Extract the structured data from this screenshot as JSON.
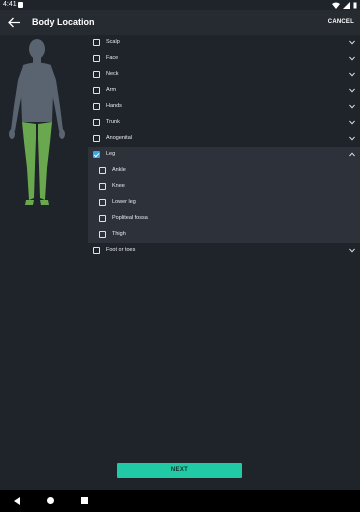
{
  "status_bar": {
    "time": "4:41",
    "icons": [
      "sim-icon",
      "wifi-icon",
      "signal-icon",
      "battery-icon"
    ]
  },
  "app_bar": {
    "back_icon": "arrow-left-icon",
    "title": "Body Location",
    "cancel_label": "CANCEL"
  },
  "figure": {
    "highlighted_region": "Leg",
    "body_color": "#5a6470",
    "highlight_color": "#6aa84f"
  },
  "locations": [
    {
      "label": "Scalp",
      "checked": false,
      "expanded": false
    },
    {
      "label": "Face",
      "checked": false,
      "expanded": false
    },
    {
      "label": "Neck",
      "checked": false,
      "expanded": false
    },
    {
      "label": "Arm",
      "checked": false,
      "expanded": false
    },
    {
      "label": "Hands",
      "checked": false,
      "expanded": false
    },
    {
      "label": "Trunk",
      "checked": false,
      "expanded": false
    },
    {
      "label": "Anogenital",
      "checked": false,
      "expanded": false
    },
    {
      "label": "Leg",
      "checked": true,
      "expanded": true,
      "children": [
        {
          "label": "Ankle",
          "checked": false
        },
        {
          "label": "Knee",
          "checked": false
        },
        {
          "label": "Lower leg",
          "checked": false
        },
        {
          "label": "Popliteal fossa",
          "checked": false
        },
        {
          "label": "Thigh",
          "checked": false
        }
      ]
    },
    {
      "label": "Foot or toes",
      "checked": false,
      "expanded": false
    }
  ],
  "next_label": "NEXT",
  "colors": {
    "background": "#1f232a",
    "app_bar": "#262a31",
    "expanded_bg": "#2d323a",
    "accent_checkbox": "#36a6e5",
    "next_button": "#1fcaa4"
  },
  "nav_bar": {
    "icons": [
      "nav-back-icon",
      "nav-home-icon",
      "nav-recents-icon"
    ]
  }
}
